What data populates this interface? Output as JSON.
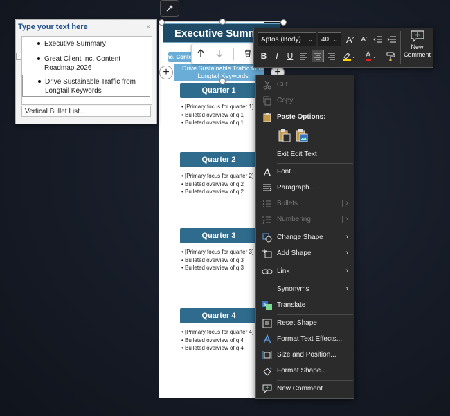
{
  "slide": {
    "title": "Executive Summary",
    "subtitle_pill": "Great Client Inc.  Content Roadmap 2026",
    "theme_pill": "Drive Sustainable Traffic from Longtail Keywords",
    "quarters": [
      {
        "label": "Quarter 1",
        "lines": [
          "• [Primary focus for quarter 1]",
          "• Bulleted overview of q 1",
          "• Bulleted overview of q 1"
        ]
      },
      {
        "label": "Quarter 2",
        "lines": [
          "• [Primary focus for quarter 2]",
          "• Bulleted overview of q 2",
          "• Bulleted overview of q 2"
        ]
      },
      {
        "label": "Quarter 3",
        "lines": [
          "• [Primary focus for quarter 3]",
          "• Bulleted overview of q 3",
          "• Bulleted overview of q 3"
        ]
      },
      {
        "label": "Quarter 4",
        "lines": [
          "• [Primary focus for quarter 4]",
          "• Bulleted overview of q 4",
          "• Bulleted overview of q 4"
        ]
      }
    ]
  },
  "text_pane": {
    "title": "Type your text here",
    "close": "×",
    "items": [
      "Executive Summary",
      "Great Client Inc.  Content Roadmap 2026",
      "Drive Sustainable Traffic from Longtail Keywords"
    ],
    "footer": "Vertical Bullet List..."
  },
  "ribbon": {
    "font": "Aptos (Body)",
    "size": "40",
    "grow": "A",
    "shrink": "A",
    "bold": "B",
    "italic": "I",
    "underline": "U",
    "font_color": "A",
    "new_comment": "New Comment"
  },
  "menu": {
    "cut": "Cut",
    "copy": "Copy",
    "paste_options": "Paste Options:",
    "exit_edit_text": "Exit Edit Text",
    "font": "Font...",
    "paragraph": "Paragraph...",
    "bullets": "Bullets",
    "numbering": "Numbering",
    "change_shape": "Change Shape",
    "add_shape": "Add Shape",
    "link": "Link",
    "synonyms": "Synonyms",
    "translate": "Translate",
    "reset_shape": "Reset Shape",
    "format_text_effects": "Format Text Effects...",
    "size_and_position": "Size and Position...",
    "format_shape": "Format Shape...",
    "new_comment": "New Comment"
  },
  "colors": {
    "title_bar": "#1f4a66",
    "quarter_box": "#2e6b8c",
    "pill": "#6aaed8",
    "highlight": "#ffd400",
    "font_color": "#e02020"
  }
}
